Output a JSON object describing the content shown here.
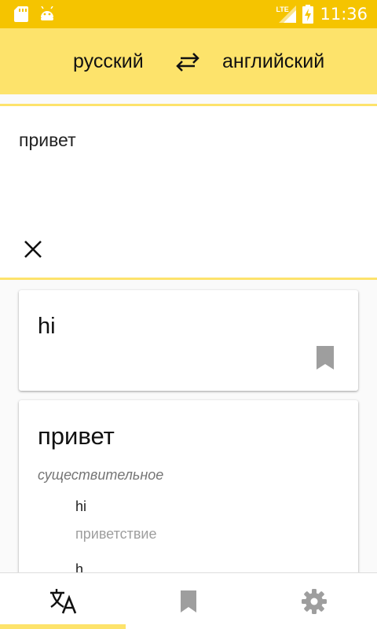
{
  "status_bar": {
    "time": "11:36",
    "network": "LTE",
    "icons": [
      "sd-card-icon",
      "android-icon",
      "signal-icon",
      "battery-charging-icon"
    ]
  },
  "header": {
    "source_language": "русский",
    "target_language": "английский",
    "swap_icon": "swap-arrows-icon"
  },
  "input": {
    "text": "привет",
    "clear_icon": "close-icon"
  },
  "translation_card": {
    "text": "hi",
    "bookmark_icon": "bookmark-icon"
  },
  "dictionary_card": {
    "word": "привет",
    "part_of_speech": "существительное",
    "meaning": "hi",
    "meaning_synonym": "приветствие",
    "next_entry": "h"
  },
  "bottom_nav": {
    "items": [
      {
        "name": "translate",
        "icon": "translate-icon",
        "active": true
      },
      {
        "name": "bookmarks",
        "icon": "bookmark-icon",
        "active": false
      },
      {
        "name": "settings",
        "icon": "gear-icon",
        "active": false
      }
    ]
  },
  "colors": {
    "status_bar": "#f5c400",
    "accent": "#fde36b",
    "icon_grey": "#9e9e9e"
  }
}
